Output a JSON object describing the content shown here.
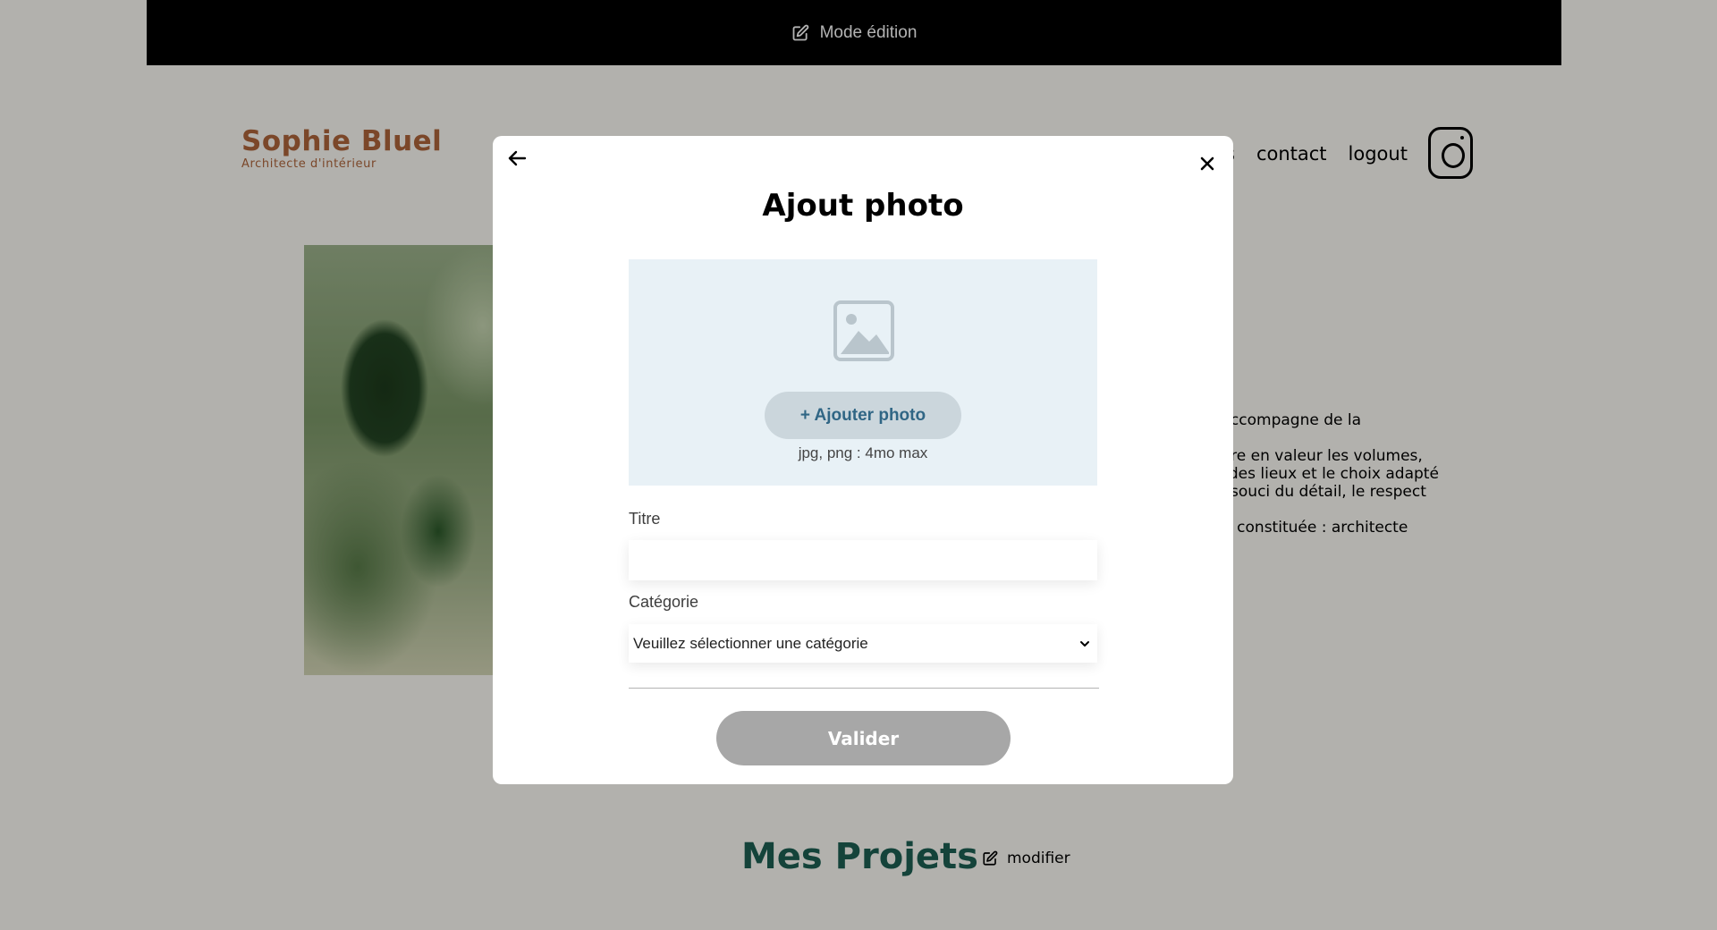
{
  "edit_bar": {
    "label": "Mode édition",
    "icon": "edit-icon"
  },
  "brand": {
    "name": "Sophie Bluel",
    "subtitle": "Architecte d'intérieur",
    "color": "#b1663c"
  },
  "nav": {
    "items": [
      "s",
      "contact",
      "logout"
    ],
    "instagram_icon": "instagram-icon"
  },
  "intro": {
    "paragraphs": [
      "vous accompagne de la",
      "a mettre en valeur les volumes,\nesprit des lieux et le choix adapté\nans le souci du détail, le respect",
      "ut-être constituée : architecte"
    ]
  },
  "projects": {
    "title": "Mes Projets",
    "modify_label": "modifier",
    "title_color": "#1d6154"
  },
  "modal": {
    "title": "Ajout photo",
    "back_icon": "arrow-left-icon",
    "close_icon": "close-icon",
    "upload": {
      "icon": "image-placeholder-icon",
      "button_label": "+ Ajouter photo",
      "hint": "jpg, png : 4mo max"
    },
    "title_field": {
      "label": "Titre",
      "value": ""
    },
    "category_field": {
      "label": "Catégorie",
      "selected": "Veuillez sélectionner une catégorie"
    },
    "submit_label": "Valider",
    "submit_color": "#a7a7a7",
    "upload_bg": "#e8f1f6"
  }
}
